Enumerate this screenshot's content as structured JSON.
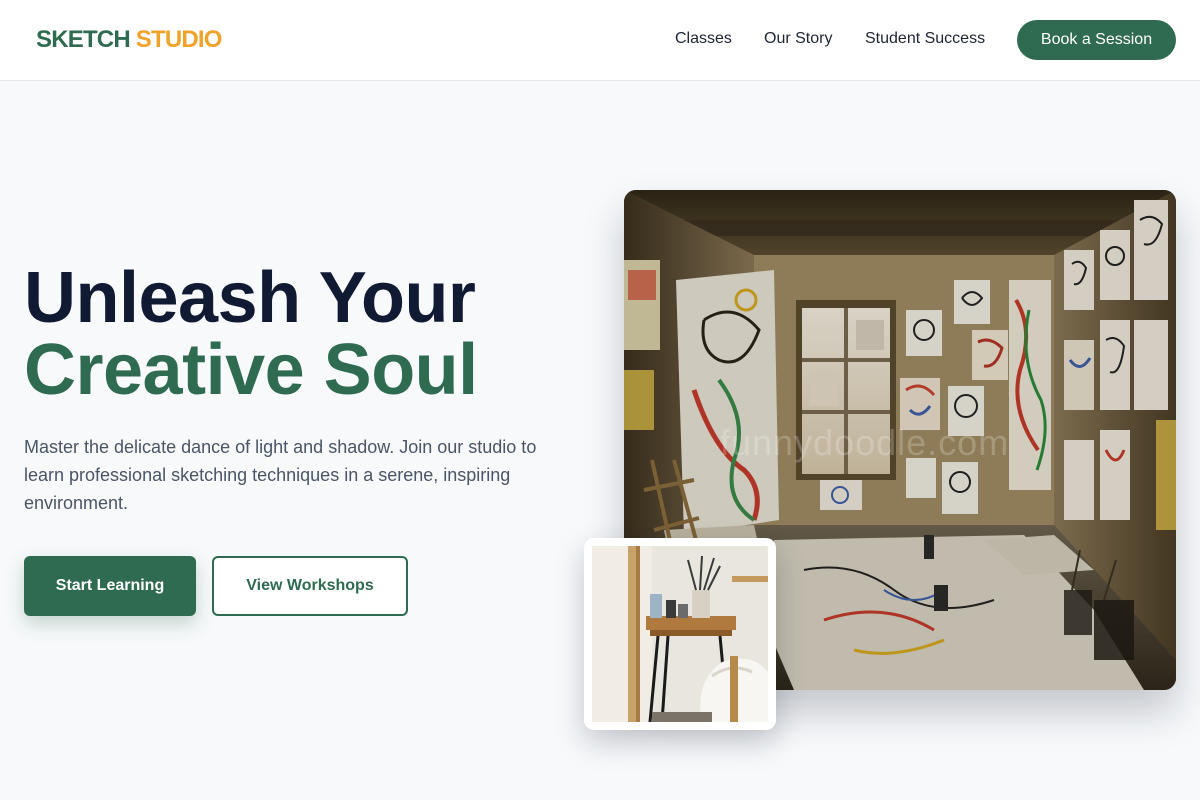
{
  "brand": {
    "part1": "SKETCH",
    "part2": "STUDIO"
  },
  "nav": {
    "links": [
      {
        "label": "Classes"
      },
      {
        "label": "Our Story"
      },
      {
        "label": "Student Success"
      }
    ],
    "cta_label": "Book a Session"
  },
  "hero": {
    "title_line1": "Unleash Your",
    "title_line2": "Creative Soul",
    "description": "Master the delicate dance of light and shadow. Join our studio to learn professional sketching techniques in a serene, inspiring environment.",
    "primary_button": "Start Learning",
    "secondary_button": "View Workshops",
    "image_watermark": "funnydoodle.com"
  },
  "colors": {
    "accent": "#2f6b50",
    "brand_orange": "#f0a22a",
    "heading": "#111a33",
    "body_text": "#4b5566",
    "page_bg": "#f7f9fb"
  }
}
